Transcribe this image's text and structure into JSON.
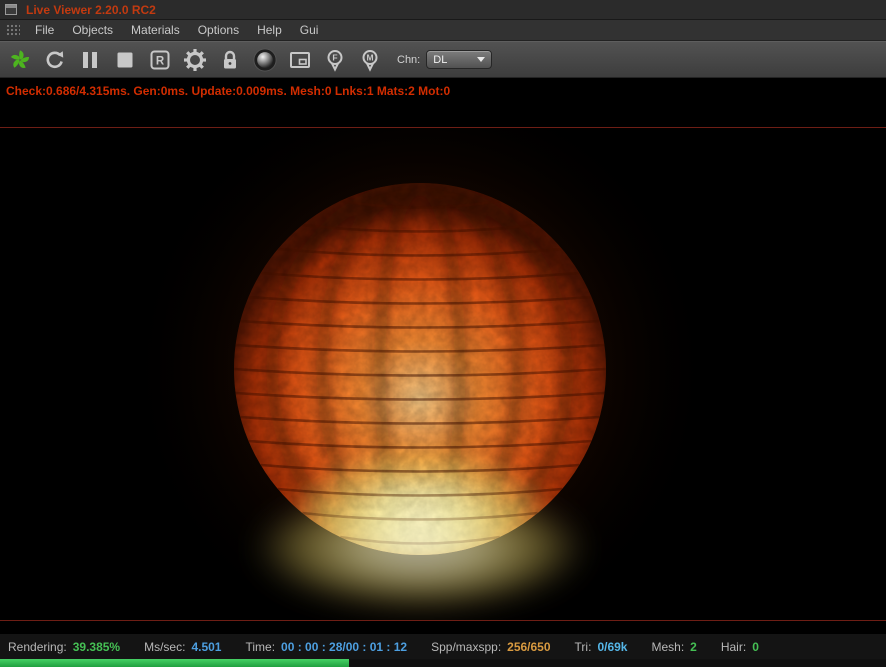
{
  "window": {
    "title": "Live Viewer 2.20.0 RC2"
  },
  "menu": {
    "items": [
      {
        "label": "File"
      },
      {
        "label": "Objects"
      },
      {
        "label": "Materials"
      },
      {
        "label": "Options"
      },
      {
        "label": "Help"
      },
      {
        "label": "Gui"
      }
    ]
  },
  "toolbar": {
    "icons": [
      {
        "name": "octane-logo",
        "color": "#4db41f"
      },
      {
        "name": "refresh"
      },
      {
        "name": "pause"
      },
      {
        "name": "stop"
      },
      {
        "name": "restart",
        "glyph": "R"
      },
      {
        "name": "settings-gear"
      },
      {
        "name": "lock"
      },
      {
        "name": "material-ball"
      },
      {
        "name": "region-render"
      },
      {
        "name": "focus-picker",
        "glyph": "F"
      },
      {
        "name": "material-picker",
        "glyph": "M"
      }
    ],
    "channel": {
      "label": "Chn:",
      "value": "DL"
    }
  },
  "status_top": {
    "text": "Check:0.686/4.315ms. Gen:0ms. Update:0.009ms. Mesh:0 Lnks:1 Mats:2 Mot:0",
    "color": "#d22d00"
  },
  "scene": {
    "description": "glowing orange paper lantern on black background"
  },
  "statusbar": {
    "items": [
      {
        "label": "Rendering:",
        "value": "39.385%",
        "color": "#45c054"
      },
      {
        "label": "Ms/sec:",
        "value": "4.501",
        "color": "#4d9fe0"
      },
      {
        "label": "Time:",
        "value": "00 : 00 : 28/00 : 01 : 12",
        "color": "#4d9fe0"
      },
      {
        "label": "Spp/maxspp:",
        "value": "256/650",
        "color": "#d89a40"
      },
      {
        "label": "Tri:",
        "value": "0/69k",
        "color": "#55b7e8"
      },
      {
        "label": "Mesh:",
        "value": "2",
        "color": "#45c054"
      },
      {
        "label": "Hair:",
        "value": "0",
        "color": "#45c054"
      }
    ]
  },
  "progress": {
    "percent": 39.385,
    "color": "#2dbd4e"
  },
  "colors": {
    "title_accent": "#c23a10",
    "separator": "#6e1e15"
  }
}
